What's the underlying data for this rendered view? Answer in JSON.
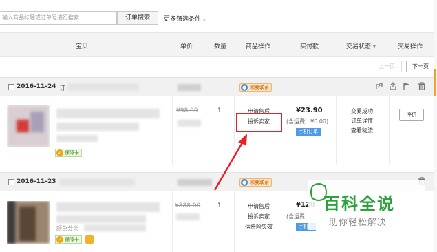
{
  "toolbar": {
    "search_placeholder": "输入商品标题或订单号进行搜索",
    "search_button": "订单搜索",
    "more_filters": "更多筛选条件",
    "more_caret": "⌄"
  },
  "table_header": {
    "columns": [
      "宝贝",
      "单价",
      "数量",
      "商品操作",
      "实付款",
      "交易状态",
      "交易操作"
    ],
    "status_caret": "▾"
  },
  "pager": {
    "prev": "上一页",
    "next": "下一页"
  },
  "orders": [
    {
      "date": "2016-11-24",
      "order_no_label": "订",
      "contact_label": "和我联系",
      "guarantee_label": "保障卡",
      "price_original": "¥98.00",
      "quantity": "1",
      "ops": [
        "申请售后",
        "投诉卖家"
      ],
      "paid": "¥23.90",
      "shipping": "(含运费：¥0.00)",
      "mobile_tag": "手机订单",
      "status": [
        "交易成功",
        "订单详情",
        "查看物流"
      ],
      "action": "评价"
    },
    {
      "date": "2016-11-23",
      "contact_label": "和我联系",
      "guarantee_label": "保障卡",
      "color_label": "颜色分类",
      "price_original": "¥888.00",
      "quantity": "1",
      "ops": [
        "申请售后",
        "投诉卖家",
        "运费险失效"
      ],
      "paid": "¥128",
      "shipping": "(含运费",
      "mobile_tag": "手机订"
    }
  ],
  "icons": {
    "share": "share-icon",
    "export": "upload-icon",
    "flag": "flag-icon",
    "delete": "trash-icon"
  },
  "watermark": {
    "title": "百科全说",
    "subtitle": "助你轻松解决"
  },
  "colors": {
    "highlight": "#e8202a",
    "watermark_green": "#2aa13a",
    "mobile_tag": "#4f9ae3"
  }
}
